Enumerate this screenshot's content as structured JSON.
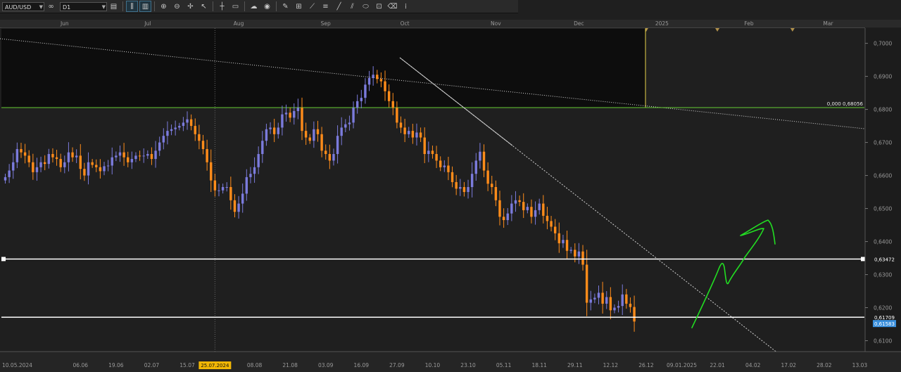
{
  "toolbar": {
    "symbol": "AUD/USD",
    "timeframe": "D1",
    "buttons": [
      {
        "name": "chain-link-icon",
        "glyph": "∞"
      },
      {
        "name": "chart-type-icon",
        "glyph": "▤"
      },
      {
        "name": "bar-chart-icon",
        "glyph": "⫼"
      },
      {
        "name": "candle-chart-icon",
        "glyph": "▥"
      },
      {
        "name": "zoom-in-icon",
        "glyph": "⊕"
      },
      {
        "name": "zoom-out-icon",
        "glyph": "⊖"
      },
      {
        "name": "crosshair-icon",
        "glyph": "✢"
      },
      {
        "name": "cursor-icon",
        "glyph": "↖"
      },
      {
        "name": "vertical-line-icon",
        "glyph": "┼"
      },
      {
        "name": "folder-icon",
        "glyph": "▭"
      },
      {
        "name": "cloud-icon",
        "glyph": "☁"
      },
      {
        "name": "globe-icon",
        "glyph": "◉"
      },
      {
        "name": "pencil-icon",
        "glyph": "✎"
      },
      {
        "name": "price-label-icon",
        "glyph": "⊞"
      },
      {
        "name": "trend-tool-icon",
        "glyph": "⟋"
      },
      {
        "name": "fib-tool-icon",
        "glyph": "≡"
      },
      {
        "name": "line-tool-icon",
        "glyph": "╱"
      },
      {
        "name": "channel-tool-icon",
        "glyph": "⫽"
      },
      {
        "name": "shape-tool-icon",
        "glyph": "⬭"
      },
      {
        "name": "text-tool-icon",
        "glyph": "⊡"
      },
      {
        "name": "eraser-icon",
        "glyph": "⌫"
      },
      {
        "name": "indicator-icon",
        "glyph": "⁞"
      }
    ]
  },
  "colors": {
    "background": "#1f1f1f",
    "bull": "#7b7bdc",
    "bear": "#ff8c1a",
    "support_line": "#ffffff",
    "horizontal_green": "#66cc33",
    "vline_yellow": "#e8d34a",
    "drawing_green": "#22dd22",
    "price_tag": "#3a8fdc",
    "date_tag": "#f2b705",
    "marker": "#b0904a"
  },
  "chart": {
    "price_min": 0.6067,
    "price_max": 0.7046,
    "price_ticks": [
      "0,7000",
      "0,6900",
      "0,6800",
      "0,6700",
      "0,6600",
      "0,6500",
      "0,6400",
      "0,6300",
      "0,6200",
      "0,6100"
    ],
    "month_labels": [
      {
        "label": "Jun",
        "idx": 15
      },
      {
        "label": "Jul",
        "idx": 36
      },
      {
        "label": "Aug",
        "idx": 59
      },
      {
        "label": "Sep",
        "idx": 81
      },
      {
        "label": "Oct",
        "idx": 101
      },
      {
        "label": "Nov",
        "idx": 124
      },
      {
        "label": "Dec",
        "idx": 145
      },
      {
        "label": "2025",
        "idx": 166
      },
      {
        "label": "Feb",
        "idx": 188
      },
      {
        "label": "Mar",
        "idx": 208
      }
    ],
    "month_marker_idx": [
      35,
      53,
      79,
      101,
      122,
      143,
      162,
      180,
      199
    ],
    "date_labels": [
      {
        "label": "10.05.2024",
        "idx": 0
      },
      {
        "label": "06.06",
        "idx": 19
      },
      {
        "label": "19.06",
        "idx": 28
      },
      {
        "label": "02.07",
        "idx": 37
      },
      {
        "label": "15.07",
        "idx": 46
      },
      {
        "label": "08.08",
        "idx": 63
      },
      {
        "label": "21.08",
        "idx": 72
      },
      {
        "label": "03.09",
        "idx": 81
      },
      {
        "label": "16.09",
        "idx": 90
      },
      {
        "label": "27.09",
        "idx": 99
      },
      {
        "label": "10.10",
        "idx": 108
      },
      {
        "label": "23.10",
        "idx": 117
      },
      {
        "label": "05.11",
        "idx": 126
      },
      {
        "label": "18.11",
        "idx": 135
      },
      {
        "label": "29.11",
        "idx": 144
      },
      {
        "label": "12.12",
        "idx": 153
      },
      {
        "label": "26.12",
        "idx": 162
      },
      {
        "label": "09.01.2025",
        "idx": 171
      },
      {
        "label": "22.01",
        "idx": 180
      },
      {
        "label": "04.02",
        "idx": 189
      },
      {
        "label": "17.02",
        "idx": 198
      },
      {
        "label": "28.02",
        "idx": 207
      },
      {
        "label": "13.03",
        "idx": 216
      }
    ],
    "highlight_date": {
      "label": "25.07.2024",
      "idx": 53
    },
    "fib_label": "0,000 0,68056",
    "fib_price": 0.68056,
    "level_upper": {
      "price": 0.63472,
      "label": "0,63472"
    },
    "level_lower": {
      "price": 0.61709,
      "label": "0,61709"
    },
    "current_price": {
      "price": 0.61583,
      "label": "0,61583"
    },
    "closes": [
      0.6595,
      0.6615,
      0.664,
      0.668,
      0.667,
      0.666,
      0.664,
      0.661,
      0.6625,
      0.664,
      0.6635,
      0.6665,
      0.6655,
      0.665,
      0.6625,
      0.664,
      0.667,
      0.6655,
      0.666,
      0.662,
      0.66,
      0.664,
      0.6632,
      0.6625,
      0.6613,
      0.6628,
      0.663,
      0.6655,
      0.666,
      0.667,
      0.6655,
      0.664,
      0.665,
      0.666,
      0.6658,
      0.666,
      0.6665,
      0.665,
      0.6675,
      0.67,
      0.672,
      0.6735,
      0.674,
      0.6745,
      0.675,
      0.676,
      0.677,
      0.675,
      0.6725,
      0.6705,
      0.668,
      0.664,
      0.6585,
      0.6555,
      0.6555,
      0.6565,
      0.6565,
      0.6525,
      0.649,
      0.6515,
      0.6545,
      0.6595,
      0.6605,
      0.6625,
      0.6665,
      0.6705,
      0.674,
      0.6745,
      0.6725,
      0.6745,
      0.6785,
      0.679,
      0.6775,
      0.6795,
      0.6805,
      0.6735,
      0.6715,
      0.6705,
      0.674,
      0.6725,
      0.6675,
      0.6665,
      0.6645,
      0.6665,
      0.672,
      0.6745,
      0.6755,
      0.676,
      0.6805,
      0.6825,
      0.6835,
      0.6875,
      0.6895,
      0.6905,
      0.6892,
      0.6885,
      0.6855,
      0.6825,
      0.6805,
      0.676,
      0.6745,
      0.6725,
      0.6735,
      0.6715,
      0.673,
      0.6715,
      0.6665,
      0.6675,
      0.6665,
      0.6645,
      0.6625,
      0.663,
      0.661,
      0.658,
      0.656,
      0.6565,
      0.655,
      0.6565,
      0.6605,
      0.6645,
      0.6672,
      0.6615,
      0.6575,
      0.6565,
      0.6525,
      0.6475,
      0.6465,
      0.6485,
      0.6515,
      0.6525,
      0.652,
      0.6495,
      0.6505,
      0.6475,
      0.6495,
      0.6515,
      0.6478,
      0.6462,
      0.6445,
      0.6425,
      0.6395,
      0.6405,
      0.6372,
      0.6375,
      0.6355,
      0.637,
      0.633,
      0.6215,
      0.6225,
      0.623,
      0.6245,
      0.6212,
      0.6232,
      0.6192,
      0.62,
      0.6205,
      0.624,
      0.6212,
      0.6202,
      0.6158
    ]
  }
}
